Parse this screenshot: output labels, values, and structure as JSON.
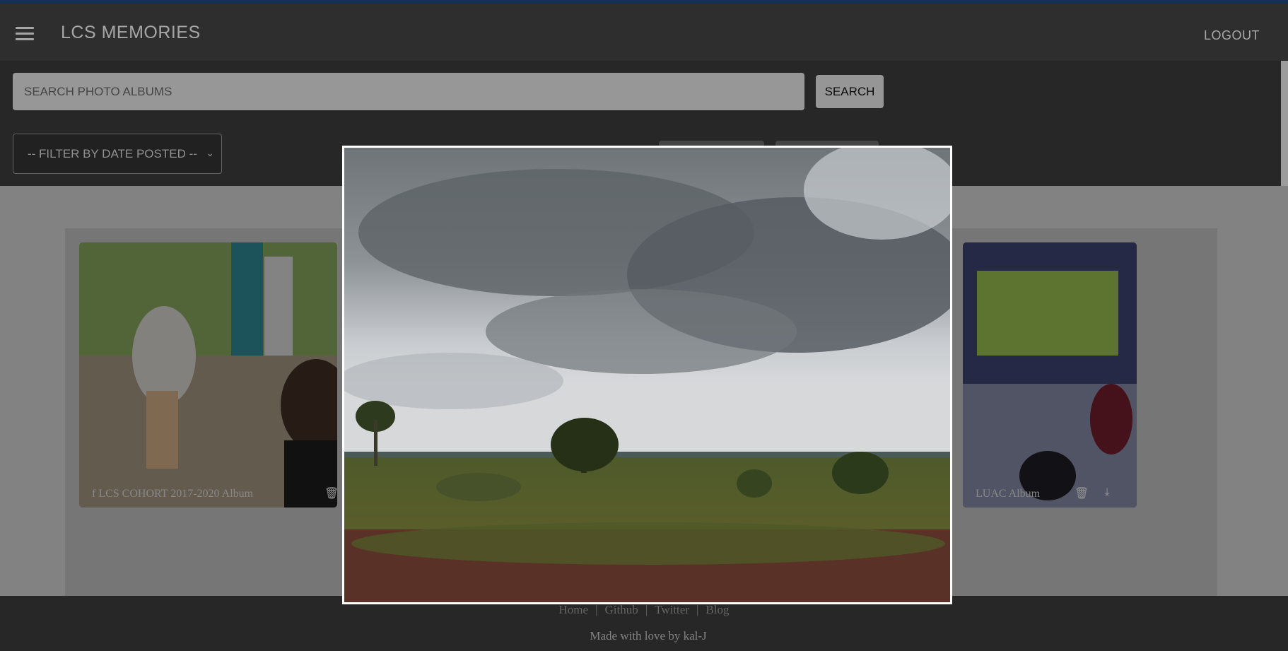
{
  "header": {
    "title": "LCS MEMORIES",
    "logout_label": "LOGOUT"
  },
  "search": {
    "placeholder": "SEARCH PHOTO ALBUMS",
    "button_label": "SEARCH",
    "filter_label": "-- FILTER BY DATE POSTED --"
  },
  "albums": [
    {
      "caption": "f LCS COHORT 2017-2020 Album"
    },
    {
      "caption": "LUAC Album"
    }
  ],
  "footer": {
    "links": [
      "Home",
      "Github",
      "Twitter",
      "Blog"
    ],
    "separator": "|",
    "credit": "Made with love by kal-J"
  },
  "modal": {
    "image_subject": "landscape-photo"
  },
  "colors": {
    "appbar": "#484848",
    "accent_topline": "#1f4a86",
    "searchbar": "#3c3c3c"
  }
}
